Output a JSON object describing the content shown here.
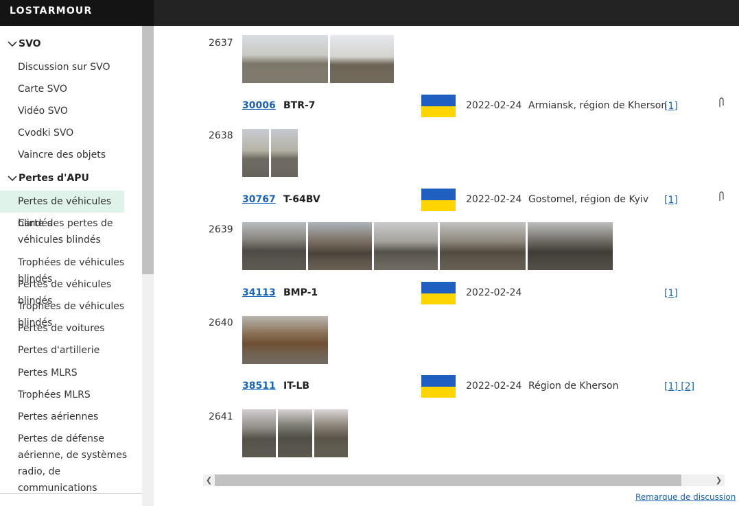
{
  "app": {
    "brand": "LOSTARMOUR"
  },
  "sidebar": {
    "sections": [
      {
        "label": "SVO"
      },
      {
        "label": "Pertes d'APU"
      }
    ],
    "svo_items": [
      "Discussion sur SVO",
      "Carte SVO",
      "Vidéo SVO",
      "Cvodki SVO",
      "Vaincre des objets"
    ],
    "apu_items": [
      "Pertes de véhicules blindés",
      "Carte des pertes de véhicules blindés",
      "Trophées de véhicules blindés",
      "Pertes de véhicules blindés",
      "Trophées de véhicules blindés",
      "Pertes de voitures",
      "Pertes d'artillerie",
      "Pertes MLRS",
      "Trophées MLRS",
      "Pertes aériennes",
      "Pertes de défense aérienne, de systèmes radio, de communications"
    ],
    "active_item": "Pertes de véhicules blindés"
  },
  "rows": [
    {
      "num": "2637",
      "thumb_count": 2
    },
    {
      "num": "2638",
      "thumb_count": 2,
      "id": "30006",
      "type": "BTR-7",
      "date": "2022-02-24",
      "location": "Armiansk, région de Kherson",
      "links": "[1]"
    },
    {
      "num": "2639",
      "thumb_count": 5,
      "id": "30767",
      "type": "T-64BV",
      "date": "2022-02-24",
      "location": "Gostomel, région de Kyiv",
      "links": "[1]"
    },
    {
      "num": "2640",
      "thumb_count": 1,
      "id": "34113",
      "type": "BMP-1",
      "date": "2022-02-24",
      "location": "",
      "links": "[1]"
    },
    {
      "num": "2641",
      "thumb_count": 3,
      "id": "38511",
      "type": "IT-LB",
      "date": "2022-02-24",
      "location": "Région de Kherson",
      "links": "[1] [2]"
    }
  ],
  "footer": {
    "link": "Remarque de discussion"
  },
  "colors": {
    "flag_blue": "#1f5fbf",
    "flag_yellow": "#ffd500",
    "link": "#1a63b5",
    "active_bg": "#dff3ea"
  }
}
